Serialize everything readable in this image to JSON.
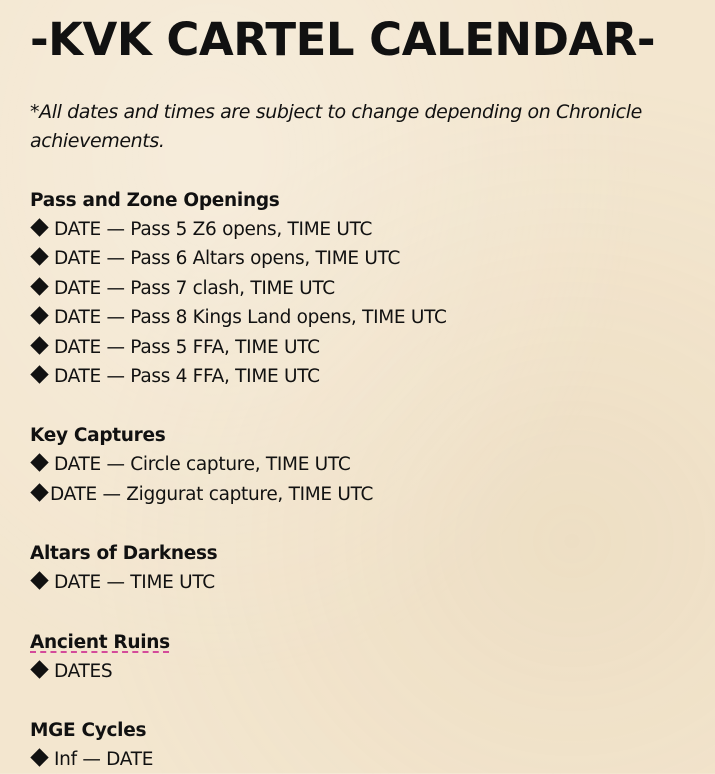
{
  "title": "-KVK CARTEL CALENDAR-",
  "note": "*All dates and times are subject to change depending on Chronicle achievements.",
  "sections": [
    {
      "heading": "Pass and Zone Openings",
      "items": [
        "DATE — Pass 5 Z6 opens, TIME UTC",
        "DATE — Pass 6 Altars opens, TIME UTC",
        "DATE — Pass 7 clash, TIME UTC",
        "DATE — Pass 8 Kings Land opens, TIME UTC",
        "DATE — Pass 5 FFA, TIME UTC",
        "DATE — Pass 4 FFA, TIME UTC"
      ]
    },
    {
      "heading": "Key Captures",
      "items": [
        "DATE — Circle capture, TIME UTC",
        "DATE — Ziggurat capture, TIME UTC"
      ]
    },
    {
      "heading": "Altars of Darkness",
      "items": [
        "DATE — TIME UTC"
      ]
    },
    {
      "heading": "Ancient Ruins",
      "items": [
        "DATES"
      ]
    },
    {
      "heading": "MGE Cycles",
      "items": [
        "Inf — DATE"
      ]
    }
  ],
  "icons": {
    "bullet": "diamond-bullet-icon"
  },
  "colors": {
    "background": "#f3e6cf",
    "text": "#111111",
    "spellcheck_underline": "#d44a9a"
  }
}
